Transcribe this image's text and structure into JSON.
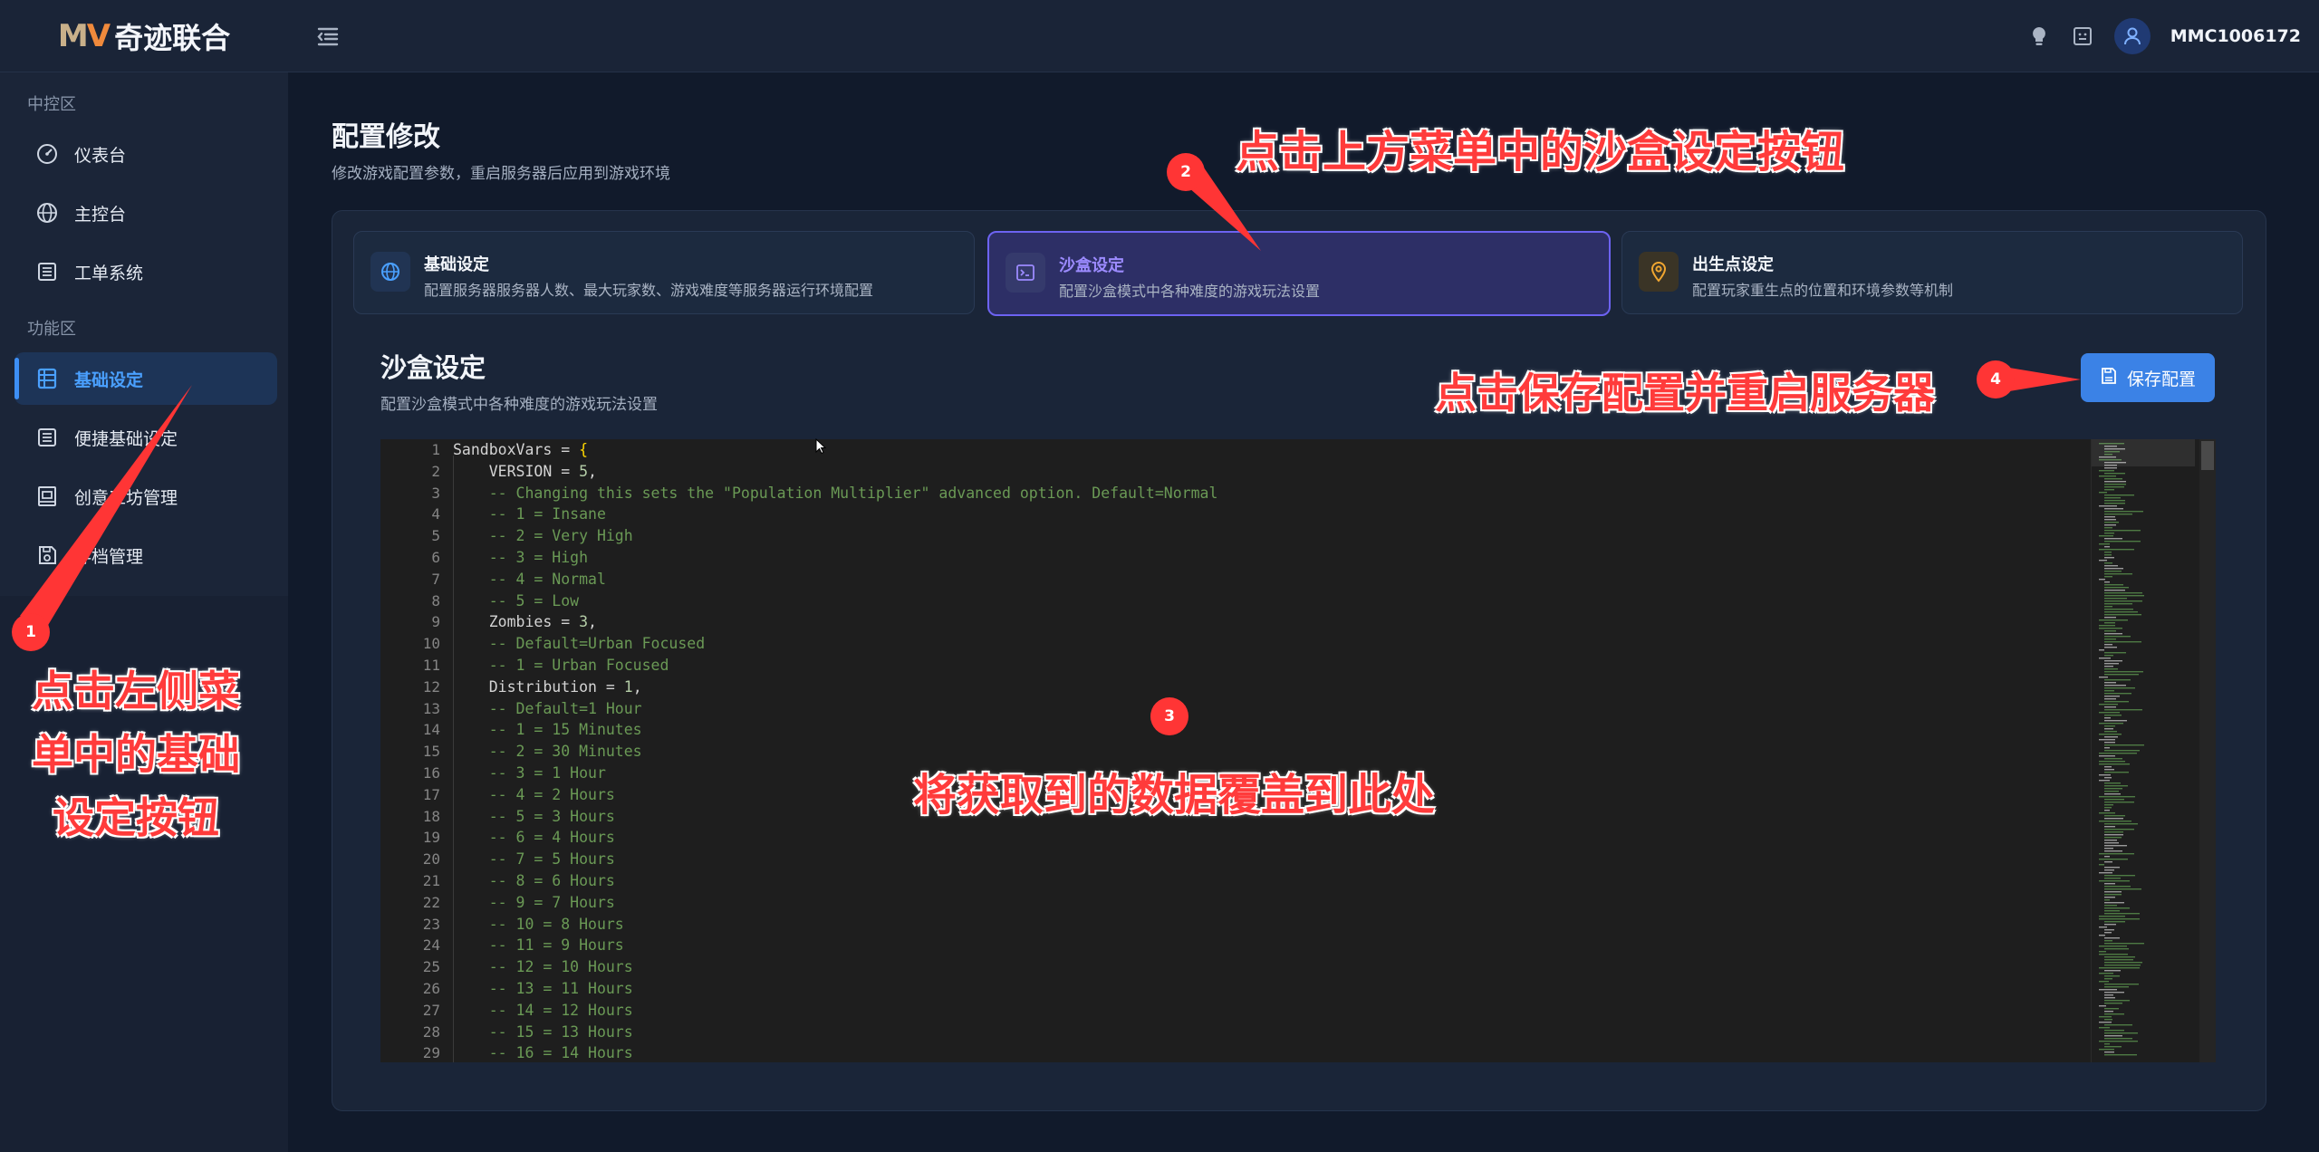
{
  "app": {
    "logo_mark": "MV",
    "logo_text": "奇迹联合",
    "username": "MMC1006172"
  },
  "sidebar": {
    "sections": [
      {
        "label": "中控区",
        "items": [
          {
            "label": "仪表台",
            "icon": "speedometer-icon"
          },
          {
            "label": "主控台",
            "icon": "globe-icon"
          },
          {
            "label": "工单系统",
            "icon": "list-icon"
          }
        ]
      },
      {
        "label": "功能区",
        "items": [
          {
            "label": "基础设定",
            "icon": "table-icon",
            "active": true
          },
          {
            "label": "便捷基础设定",
            "icon": "list-icon"
          },
          {
            "label": "创意工坊管理",
            "icon": "building-icon"
          },
          {
            "label": "存档管理",
            "icon": "save-icon"
          }
        ]
      }
    ]
  },
  "page": {
    "title": "配置修改",
    "subtitle": "修改游戏配置参数，重启服务器后应用到游戏环境"
  },
  "tabs": [
    {
      "title": "基础设定",
      "desc": "配置服务器服务器人数、最大玩家数、游戏难度等服务器运行环境配置",
      "icon": "globe-icon"
    },
    {
      "title": "沙盒设定",
      "desc": "配置沙盒模式中各种难度的游戏玩法设置",
      "icon": "terminal-icon",
      "active": true
    },
    {
      "title": "出生点设定",
      "desc": "配置玩家重生点的位置和环境参数等机制",
      "icon": "location-pin-icon"
    }
  ],
  "section": {
    "title": "沙盒设定",
    "subtitle": "配置沙盒模式中各种难度的游戏玩法设置",
    "save_label": "保存配置"
  },
  "editor": {
    "lines": [
      {
        "n": "1",
        "text": "SandboxVars = {",
        "kind": "head"
      },
      {
        "n": "2",
        "text": "    VERSION = 5,",
        "kind": "assign"
      },
      {
        "n": "3",
        "text": "    -- Changing this sets the \"Population Multiplier\" advanced option. Default=Normal",
        "kind": "comment"
      },
      {
        "n": "4",
        "text": "    -- 1 = Insane",
        "kind": "comment"
      },
      {
        "n": "5",
        "text": "    -- 2 = Very High",
        "kind": "comment"
      },
      {
        "n": "6",
        "text": "    -- 3 = High",
        "kind": "comment"
      },
      {
        "n": "7",
        "text": "    -- 4 = Normal",
        "kind": "comment"
      },
      {
        "n": "8",
        "text": "    -- 5 = Low",
        "kind": "comment"
      },
      {
        "n": "9",
        "text": "    Zombies = 3,",
        "kind": "assign"
      },
      {
        "n": "10",
        "text": "    -- Default=Urban Focused",
        "kind": "comment"
      },
      {
        "n": "11",
        "text": "    -- 1 = Urban Focused",
        "kind": "comment"
      },
      {
        "n": "12",
        "text": "    Distribution = 1,",
        "kind": "assign"
      },
      {
        "n": "13",
        "text": "    -- Default=1 Hour",
        "kind": "comment"
      },
      {
        "n": "14",
        "text": "    -- 1 = 15 Minutes",
        "kind": "comment"
      },
      {
        "n": "15",
        "text": "    -- 2 = 30 Minutes",
        "kind": "comment"
      },
      {
        "n": "16",
        "text": "    -- 3 = 1 Hour",
        "kind": "comment"
      },
      {
        "n": "17",
        "text": "    -- 4 = 2 Hours",
        "kind": "comment"
      },
      {
        "n": "18",
        "text": "    -- 5 = 3 Hours",
        "kind": "comment"
      },
      {
        "n": "19",
        "text": "    -- 6 = 4 Hours",
        "kind": "comment"
      },
      {
        "n": "20",
        "text": "    -- 7 = 5 Hours",
        "kind": "comment"
      },
      {
        "n": "21",
        "text": "    -- 8 = 6 Hours",
        "kind": "comment"
      },
      {
        "n": "22",
        "text": "    -- 9 = 7 Hours",
        "kind": "comment"
      },
      {
        "n": "23",
        "text": "    -- 10 = 8 Hours",
        "kind": "comment"
      },
      {
        "n": "24",
        "text": "    -- 11 = 9 Hours",
        "kind": "comment"
      },
      {
        "n": "25",
        "text": "    -- 12 = 10 Hours",
        "kind": "comment"
      },
      {
        "n": "26",
        "text": "    -- 13 = 11 Hours",
        "kind": "comment"
      },
      {
        "n": "27",
        "text": "    -- 14 = 12 Hours",
        "kind": "comment"
      },
      {
        "n": "28",
        "text": "    -- 15 = 13 Hours",
        "kind": "comment"
      },
      {
        "n": "29",
        "text": "    -- 16 = 14 Hours",
        "kind": "comment"
      }
    ]
  },
  "annotations": {
    "step1_badge": "1",
    "step1_text_lines": [
      "点击左侧菜",
      "单中的基础",
      "设定按钮"
    ],
    "step2_badge": "2",
    "step2_text": "点击上方菜单中的沙盒设定按钮",
    "step3_badge": "3",
    "step3_text": "将获取到的数据覆盖到此处",
    "step4_badge": "4",
    "step4_text": "点击保存配置并重启服务器"
  },
  "colors": {
    "accent": "#3b82e6",
    "active_tab_border": "#6d63f2",
    "annotation_red": "#ff3b3b",
    "comment_green": "#6a9955"
  }
}
